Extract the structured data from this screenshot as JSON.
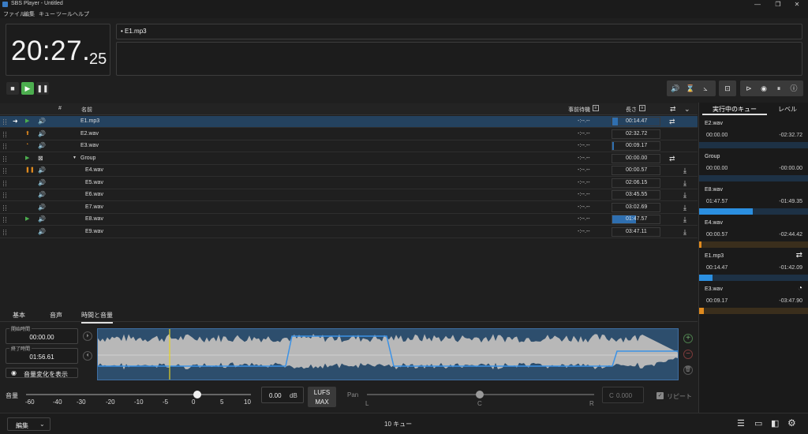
{
  "window": {
    "title": "SBS Player - Untitled",
    "controls": [
      "—",
      "❐",
      "✕"
    ]
  },
  "menu": [
    "ファイル",
    "編集",
    "キュー",
    "ツール",
    "ヘルプ"
  ],
  "clock": {
    "main": "20:27.",
    "fraction": "25"
  },
  "now_playing": "• E1.mp3",
  "list": {
    "headers": {
      "number": "#",
      "name": "名前",
      "prewait": "事前待機",
      "length": "長さ"
    },
    "rows": [
      {
        "name": "E1.mp3",
        "prewait": "-:--.--",
        "length": "00:14.47",
        "selected": true,
        "loop": true,
        "fill": 0.12
      },
      {
        "name": "E2.wav",
        "prewait": "-:--.--",
        "length": "02:32.72"
      },
      {
        "name": "E3.wav",
        "prewait": "-:--.--",
        "length": "00:09.17",
        "fill": 0.03
      },
      {
        "name": "Group",
        "prewait": "-:--.--",
        "length": "00:00.00",
        "loop": true
      },
      {
        "name": "E4.wav",
        "prewait": "-:--.--",
        "length": "00:00.57",
        "down": true
      },
      {
        "name": "E5.wav",
        "prewait": "-:--.--",
        "length": "02:06.15",
        "down": true
      },
      {
        "name": "E6.wav",
        "prewait": "-:--.--",
        "length": "03:45.55",
        "down": true
      },
      {
        "name": "E7.wav",
        "prewait": "-:--.--",
        "length": "03:02.69",
        "down": true
      },
      {
        "name": "E8.wav",
        "prewait": "-:--.--",
        "length": "01:47.57",
        "down": true,
        "fill": 0.5
      },
      {
        "name": "E9.wav",
        "prewait": "-:--.--",
        "length": "03:47.11",
        "down": true
      }
    ]
  },
  "right_panel": {
    "tabs": [
      "実行中のキュー",
      "レベル"
    ],
    "cards": [
      {
        "name": "E2.wav",
        "elapsed": "00:00.00",
        "remaining": "-02:32.72",
        "progress": 0.0,
        "color": "#2b8fe0"
      },
      {
        "name": "Group",
        "elapsed": "00:00.00",
        "remaining": "-00:00.00",
        "progress": 0.0,
        "color": "#2b8fe0"
      },
      {
        "name": "E8.wav",
        "elapsed": "01:47.57",
        "remaining": "-01:49.35",
        "progress": 0.49,
        "color": "#2b8fe0"
      },
      {
        "name": "E4.wav",
        "elapsed": "00:00.57",
        "remaining": "-02:44.42",
        "progress": 0.003,
        "color": "#e08a1e"
      },
      {
        "name": "E1.mp3",
        "elapsed": "00:14.47",
        "remaining": "-01:42.09",
        "progress": 0.12,
        "color": "#2b8fe0"
      },
      {
        "name": "E3.wav",
        "elapsed": "00:09.17",
        "remaining": "-03:47.90",
        "progress": 0.04,
        "color": "#e08a1e"
      }
    ]
  },
  "editor": {
    "tabs": [
      "基本",
      "音声",
      "時間と音量"
    ],
    "start_label": "開始時間",
    "start_value": "00:00.00",
    "end_label": "終了時間",
    "end_value": "01:56.61",
    "show_volume_button": "音量変化を表示",
    "volume_label": "音量",
    "volume_ticks": [
      "-60",
      "-40",
      "-30",
      "-20",
      "-10",
      "-5",
      "0",
      "5",
      "10"
    ],
    "volume_value": "0.00",
    "volume_unit": "dB",
    "lufs": "LUFS",
    "max": "MAX",
    "pan_label": "Pan",
    "pan_ticks": [
      "L",
      "C",
      "R"
    ],
    "pan_value_prefix": "C",
    "pan_value": "0.000",
    "repeat_label": "リピート"
  },
  "status": {
    "edit_button": "編集",
    "cue_count": "10 キュー"
  }
}
